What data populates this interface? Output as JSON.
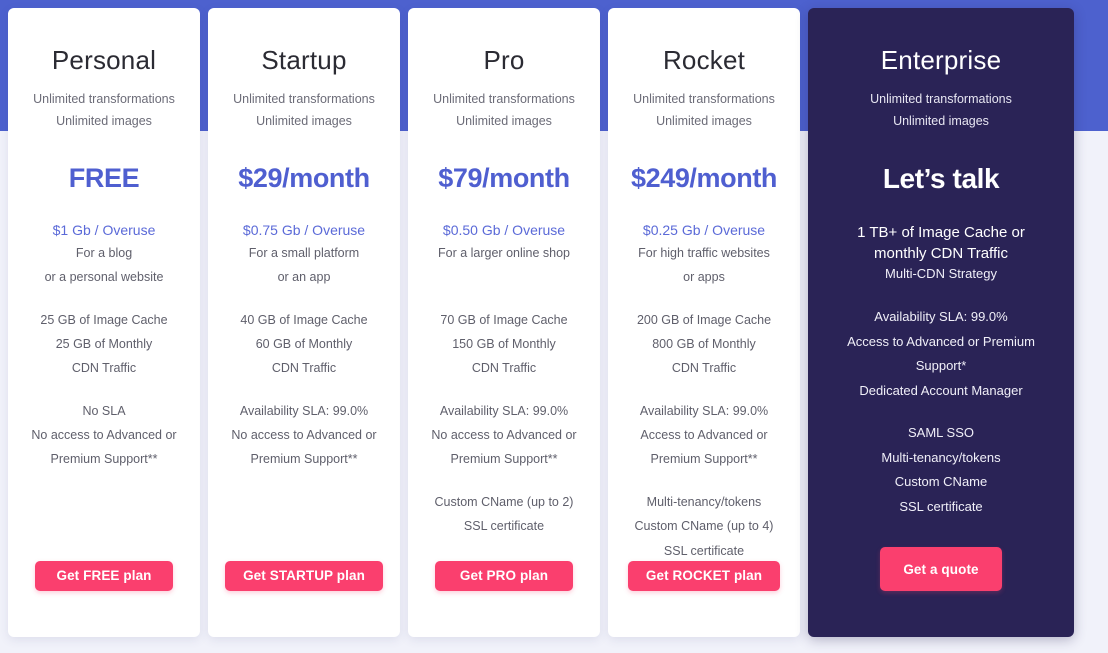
{
  "theme": {
    "page_background": "#f1f2fa",
    "hero_band_color": "#4d61ce",
    "card_background": "#ffffff",
    "enterprise_background": "#2a2356",
    "price_color": "#4f5fd0",
    "overuse_color": "#5b6ad8",
    "cta_color": "#fa3f6e",
    "cta_text_color": "#ffffff",
    "body_text_color": "#5f5f6b"
  },
  "plans": [
    {
      "id": "personal",
      "name": "Personal",
      "sub_line_1": "Unlimited transformations",
      "sub_line_2": "Unlimited images",
      "price": "FREE",
      "overuse": "$1 Gb / Overuse",
      "use_case_line_1": "For a blog",
      "use_case_line_2": "or a personal website",
      "quota_line_1": "25 GB of Image Cache",
      "quota_line_2": "25 GB of Monthly",
      "quota_line_3": "CDN Traffic",
      "support_line_1": "No SLA",
      "support_line_2": "No access to Advanced or",
      "support_line_3": "Premium Support**",
      "extra_line_1": "",
      "extra_line_2": "",
      "extra_line_3": "",
      "cta_label": "Get FREE plan"
    },
    {
      "id": "startup",
      "name": "Startup",
      "sub_line_1": "Unlimited transformations",
      "sub_line_2": "Unlimited images",
      "price": "$29/month",
      "overuse": "$0.75 Gb / Overuse",
      "use_case_line_1": "For a small platform",
      "use_case_line_2": "or an app",
      "quota_line_1": "40 GB of Image Cache",
      "quota_line_2": "60 GB of Monthly",
      "quota_line_3": "CDN Traffic",
      "support_line_1": "Availability SLA: 99.0%",
      "support_line_2": "No access to Advanced or",
      "support_line_3": "Premium Support**",
      "extra_line_1": "",
      "extra_line_2": "",
      "extra_line_3": "",
      "cta_label": "Get STARTUP plan"
    },
    {
      "id": "pro",
      "name": "Pro",
      "sub_line_1": "Unlimited transformations",
      "sub_line_2": "Unlimited images",
      "price": "$79/month",
      "overuse": "$0.50 Gb / Overuse",
      "use_case_line_1": "For a larger online shop",
      "use_case_line_2": "",
      "quota_line_1": "70 GB of Image Cache",
      "quota_line_2": "150 GB of Monthly",
      "quota_line_3": "CDN Traffic",
      "support_line_1": "Availability SLA: 99.0%",
      "support_line_2": "No access to Advanced or",
      "support_line_3": "Premium Support**",
      "extra_line_1": "Custom CName (up to 2)",
      "extra_line_2": "SSL certificate",
      "extra_line_3": "",
      "cta_label": "Get PRO plan"
    },
    {
      "id": "rocket",
      "name": "Rocket",
      "sub_line_1": "Unlimited transformations",
      "sub_line_2": "Unlimited images",
      "price": "$249/month",
      "overuse": "$0.25 Gb / Overuse",
      "use_case_line_1": "For high traffic websites",
      "use_case_line_2": "or apps",
      "quota_line_1": "200 GB of Image Cache",
      "quota_line_2": "800 GB of Monthly",
      "quota_line_3": "CDN Traffic",
      "support_line_1": "Availability SLA: 99.0%",
      "support_line_2": "Access to Advanced or",
      "support_line_3": "Premium Support**",
      "extra_line_1": "Multi-tenancy/tokens",
      "extra_line_2": "Custom CName (up to 4)",
      "extra_line_3": "SSL certificate",
      "cta_label": "Get ROCKET plan"
    }
  ],
  "enterprise": {
    "id": "enterprise",
    "name": "Enterprise",
    "sub_line_1": "Unlimited transformations",
    "sub_line_2": "Unlimited images",
    "price": "Let’s talk",
    "lead_line_1": "1 TB+ of Image Cache or",
    "lead_line_2": "monthly CDN Traffic",
    "lead_sub": "Multi-CDN Strategy",
    "support_line_1": "Availability SLA: 99.0%",
    "support_line_2": "Access to Advanced or Premium",
    "support_line_3": "Support*",
    "support_line_4": "Dedicated Account Manager",
    "extra_line_1": "SAML SSO",
    "extra_line_2": "Multi-tenancy/tokens",
    "extra_line_3": "Custom CName",
    "extra_line_4": "SSL certificate",
    "cta_label": "Get a quote"
  }
}
